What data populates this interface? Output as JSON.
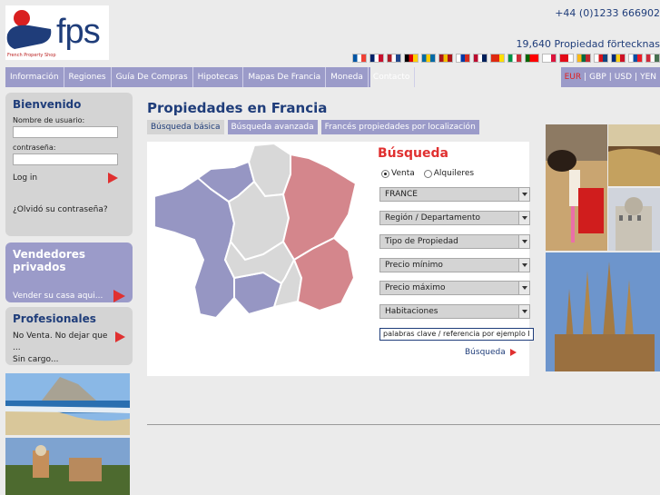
{
  "header": {
    "logo_text": "fps",
    "logo_tagline": "French Property Shop",
    "phone": "+44 (0)1233 666902",
    "property_count": "19,640 Propiedad förtecknas",
    "flags": [
      {
        "name": "france-flag",
        "colors": [
          "#0055a4",
          "#ffffff",
          "#ef4135"
        ]
      },
      {
        "name": "uk-flag",
        "colors": [
          "#012169",
          "#ffffff",
          "#c8102e"
        ]
      },
      {
        "name": "netherlands-flag",
        "colors": [
          "#ae1c28",
          "#ffffff",
          "#21468b"
        ]
      },
      {
        "name": "germany-flag",
        "colors": [
          "#000000",
          "#dd0000",
          "#ffce00"
        ]
      },
      {
        "name": "sweden-flag",
        "colors": [
          "#006aa7",
          "#fecc00",
          "#006aa7"
        ]
      },
      {
        "name": "spain-flag",
        "colors": [
          "#aa151b",
          "#f1bf00",
          "#aa151b"
        ]
      },
      {
        "name": "russia-flag",
        "colors": [
          "#ffffff",
          "#0039a6",
          "#d52b1e"
        ]
      },
      {
        "name": "norway-flag",
        "colors": [
          "#ba0c2f",
          "#ffffff",
          "#00205b"
        ]
      },
      {
        "name": "china-flag",
        "colors": [
          "#de2910",
          "#de2910",
          "#ffde00"
        ]
      },
      {
        "name": "italy-flag",
        "colors": [
          "#009246",
          "#ffffff",
          "#ce2b37"
        ]
      },
      {
        "name": "portugal-flag",
        "colors": [
          "#006600",
          "#ff0000",
          "#ff0000"
        ]
      },
      {
        "name": "poland-flag",
        "colors": [
          "#ffffff",
          "#ffffff",
          "#dc143c"
        ]
      },
      {
        "name": "turkey-flag",
        "colors": [
          "#e30a17",
          "#e30a17",
          "#ffffff"
        ]
      },
      {
        "name": "lithuania-flag",
        "colors": [
          "#fdb913",
          "#006a44",
          "#c1272d"
        ]
      },
      {
        "name": "czech-flag",
        "colors": [
          "#ffffff",
          "#d7141a",
          "#11457e"
        ]
      },
      {
        "name": "romania-flag",
        "colors": [
          "#002b7f",
          "#fcd116",
          "#ce1126"
        ]
      },
      {
        "name": "slovakia-flag",
        "colors": [
          "#ffffff",
          "#0b4ea2",
          "#ee1c25"
        ]
      },
      {
        "name": "hungary-flag",
        "colors": [
          "#ce2939",
          "#ffffff",
          "#477050"
        ]
      }
    ]
  },
  "nav": {
    "items": [
      "Información",
      "Regiones",
      "Guía De Compras",
      "Hipotecas",
      "Mapas De Francia",
      "Moneda",
      "Contacto"
    ]
  },
  "currency": {
    "items": [
      "EUR",
      "GBP",
      "USD",
      "YEN"
    ],
    "separator": "|",
    "active": "EUR",
    "active_color": "#d22222"
  },
  "login": {
    "title": "Bienvenido",
    "username_label": "Nombre de usuario:",
    "password_label": "contraseña:",
    "login_label": "Log in",
    "forgot_label": "¿Olvidó su contraseña?"
  },
  "vendors": {
    "title": "Vendedores privados",
    "link": "Vender su casa aqui..."
  },
  "professionals": {
    "title": "Profesionales",
    "line1": "No Venta. No dejar que ...",
    "line2": "Sin cargo..."
  },
  "main": {
    "title": "Propiedades en Francia",
    "tabs": [
      "Búsqueda básica",
      "Búsqueda avanzada",
      "Francés propiedades por localización"
    ],
    "active_tab": 0
  },
  "search": {
    "title": "Búsqueda",
    "radio_sale": "Venta",
    "radio_rent": "Alquileres",
    "selected_radio": "sale",
    "selects": [
      "FRANCE",
      "Región / Departamento",
      "Tipo de Propiedad",
      "Precio mínimo",
      "Precio máximo",
      "Habitaciones"
    ],
    "keywords_value": "palabras clave / referencia por ejemplo I",
    "submit_label": "Búsqueda"
  },
  "colors": {
    "accent_blue": "#1f3d7a",
    "nav_purple": "#9b9bc9",
    "accent_red": "#e03030",
    "map_west": "#9696c3",
    "map_center": "#d8d8d8",
    "map_east": "#d4868c"
  }
}
